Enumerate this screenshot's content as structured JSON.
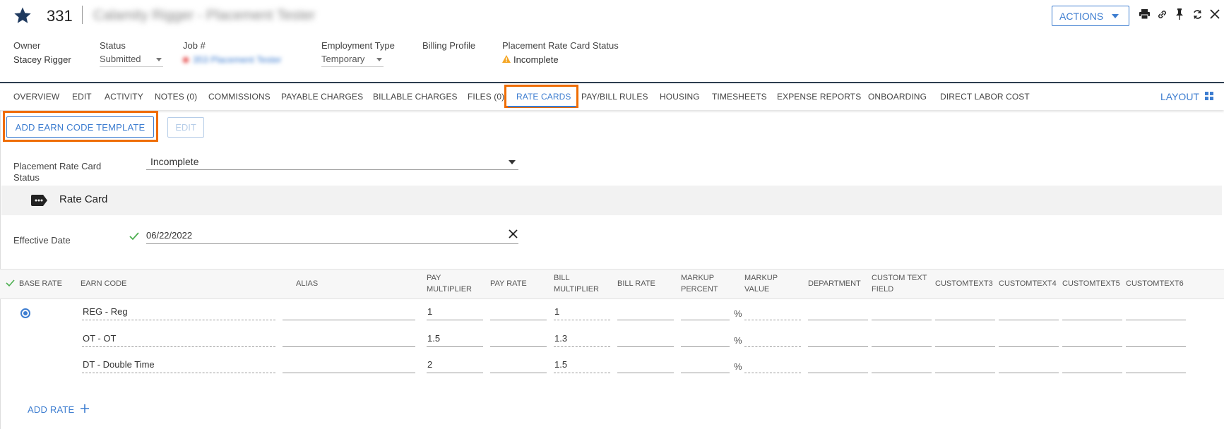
{
  "header": {
    "record_id": "331",
    "record_title": "Calamity Rigger - Placement Tester",
    "actions_label": "ACTIONS",
    "icons": [
      "star-icon",
      "print-icon",
      "link-icon",
      "pin-icon",
      "refresh-icon",
      "close-icon"
    ],
    "fields": {
      "owner_label": "Owner",
      "owner_value": "Stacey Rigger",
      "status_label": "Status",
      "status_value": "Submitted",
      "job_label": "Job #",
      "job_value": "353 Placement Tester",
      "employment_type_label": "Employment Type",
      "employment_type_value": "Temporary",
      "billing_profile_label": "Billing Profile",
      "rate_card_status_label": "Placement Rate Card Status",
      "rate_card_status_value": "Incomplete"
    }
  },
  "tabs": [
    {
      "label": "OVERVIEW"
    },
    {
      "label": "EDIT"
    },
    {
      "label": "ACTIVITY"
    },
    {
      "label": "NOTES (0)"
    },
    {
      "label": "COMMISSIONS"
    },
    {
      "label": "PAYABLE CHARGES"
    },
    {
      "label": "BILLABLE CHARGES"
    },
    {
      "label": "FILES (0)"
    },
    {
      "label": "RATE CARDS"
    },
    {
      "label": "PAY/BILL RULES"
    },
    {
      "label": "HOUSING"
    },
    {
      "label": "TIMESHEETS"
    },
    {
      "label": "EXPENSE REPORTS"
    },
    {
      "label": "ONBOARDING"
    },
    {
      "label": "DIRECT LABOR COST"
    }
  ],
  "active_tab": "RATE CARDS",
  "layout_label": "LAYOUT",
  "toolbar": {
    "add_earn_code_template": "ADD EARN CODE TEMPLATE",
    "edit": "EDIT"
  },
  "rate_card_status": {
    "label": "Placement Rate Card Status",
    "value": "Incomplete"
  },
  "section": {
    "title": "Rate Card"
  },
  "effective_date": {
    "label": "Effective Date",
    "value": "06/22/2022"
  },
  "table": {
    "columns": {
      "base_rate": "BASE RATE",
      "earn_code": "EARN CODE",
      "alias": "ALIAS",
      "pay_multiplier_1": "PAY",
      "pay_multiplier_2": "MULTIPLIER",
      "pay_rate": "PAY RATE",
      "bill_multiplier_1": "BILL",
      "bill_multiplier_2": "MULTIPLIER",
      "bill_rate": "BILL RATE",
      "markup_percent_1": "MARKUP",
      "markup_percent_2": "PERCENT",
      "markup_value_1": "MARKUP",
      "markup_value_2": "VALUE",
      "department": "DEPARTMENT",
      "custom_text_field_1": "CUSTOM TEXT",
      "custom_text_field_2": "FIELD",
      "customtext3": "CUSTOMTEXT3",
      "customtext4": "CUSTOMTEXT4",
      "customtext5": "CUSTOMTEXT5",
      "customtext6": "CUSTOMTEXT6"
    },
    "rows": [
      {
        "earn_code": "REG - Reg",
        "pay_multiplier": "1",
        "bill_multiplier": "1",
        "percent_sign": "%"
      },
      {
        "earn_code": "OT - OT",
        "pay_multiplier": "1.5",
        "bill_multiplier": "1.3",
        "percent_sign": "%"
      },
      {
        "earn_code": "DT - Double Time",
        "pay_multiplier": "2",
        "bill_multiplier": "1.5",
        "percent_sign": "%"
      }
    ]
  },
  "add_rate_label": "ADD RATE",
  "colors": {
    "accent": "#3d7dd0",
    "highlight": "#ef6c00",
    "warning": "#f5a623",
    "success": "#4caf50",
    "navy": "#1f3a5f"
  }
}
